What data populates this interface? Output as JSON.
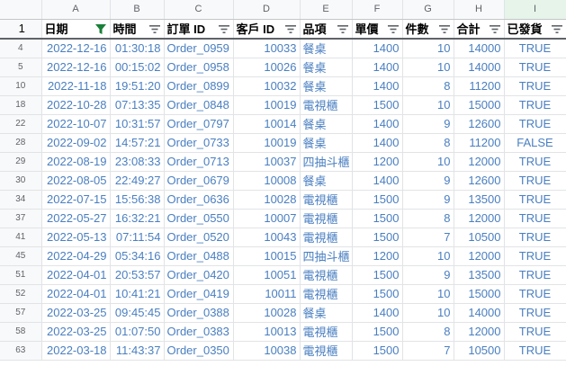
{
  "columns": [
    "A",
    "B",
    "C",
    "D",
    "E",
    "F",
    "G",
    "H",
    "I"
  ],
  "header_row_number": "1",
  "headers": [
    "日期",
    "時間",
    "訂單 ID",
    "客戶 ID",
    "品項",
    "單價",
    "件數",
    "合計",
    "已發貨"
  ],
  "rows": [
    {
      "n": "4",
      "date": "2022-12-16",
      "time": "01:30:18",
      "order": "Order_0959",
      "cust": "10033",
      "item": "餐桌",
      "price": "1400",
      "qty": "10",
      "total": "14000",
      "shipped": "TRUE"
    },
    {
      "n": "5",
      "date": "2022-12-16",
      "time": "00:15:02",
      "order": "Order_0958",
      "cust": "10026",
      "item": "餐桌",
      "price": "1400",
      "qty": "10",
      "total": "14000",
      "shipped": "TRUE"
    },
    {
      "n": "10",
      "date": "2022-11-18",
      "time": "19:51:20",
      "order": "Order_0899",
      "cust": "10032",
      "item": "餐桌",
      "price": "1400",
      "qty": "8",
      "total": "11200",
      "shipped": "TRUE"
    },
    {
      "n": "18",
      "date": "2022-10-28",
      "time": "07:13:35",
      "order": "Order_0848",
      "cust": "10019",
      "item": "電視櫃",
      "price": "1500",
      "qty": "10",
      "total": "15000",
      "shipped": "TRUE"
    },
    {
      "n": "22",
      "date": "2022-10-07",
      "time": "10:31:57",
      "order": "Order_0797",
      "cust": "10014",
      "item": "餐桌",
      "price": "1400",
      "qty": "9",
      "total": "12600",
      "shipped": "TRUE"
    },
    {
      "n": "28",
      "date": "2022-09-02",
      "time": "14:57:21",
      "order": "Order_0733",
      "cust": "10019",
      "item": "餐桌",
      "price": "1400",
      "qty": "8",
      "total": "11200",
      "shipped": "FALSE"
    },
    {
      "n": "29",
      "date": "2022-08-19",
      "time": "23:08:33",
      "order": "Order_0713",
      "cust": "10037",
      "item": "四抽斗櫃",
      "price": "1200",
      "qty": "10",
      "total": "12000",
      "shipped": "TRUE"
    },
    {
      "n": "30",
      "date": "2022-08-05",
      "time": "22:49:27",
      "order": "Order_0679",
      "cust": "10008",
      "item": "餐桌",
      "price": "1400",
      "qty": "9",
      "total": "12600",
      "shipped": "TRUE"
    },
    {
      "n": "34",
      "date": "2022-07-15",
      "time": "15:56:38",
      "order": "Order_0636",
      "cust": "10028",
      "item": "電視櫃",
      "price": "1500",
      "qty": "9",
      "total": "13500",
      "shipped": "TRUE"
    },
    {
      "n": "37",
      "date": "2022-05-27",
      "time": "16:32:21",
      "order": "Order_0550",
      "cust": "10007",
      "item": "電視櫃",
      "price": "1500",
      "qty": "8",
      "total": "12000",
      "shipped": "TRUE"
    },
    {
      "n": "41",
      "date": "2022-05-13",
      "time": "07:11:54",
      "order": "Order_0520",
      "cust": "10043",
      "item": "電視櫃",
      "price": "1500",
      "qty": "7",
      "total": "10500",
      "shipped": "TRUE"
    },
    {
      "n": "45",
      "date": "2022-04-29",
      "time": "05:34:16",
      "order": "Order_0488",
      "cust": "10015",
      "item": "四抽斗櫃",
      "price": "1200",
      "qty": "10",
      "total": "12000",
      "shipped": "TRUE"
    },
    {
      "n": "51",
      "date": "2022-04-01",
      "time": "20:53:57",
      "order": "Order_0420",
      "cust": "10051",
      "item": "電視櫃",
      "price": "1500",
      "qty": "9",
      "total": "13500",
      "shipped": "TRUE"
    },
    {
      "n": "52",
      "date": "2022-04-01",
      "time": "10:41:21",
      "order": "Order_0419",
      "cust": "10011",
      "item": "電視櫃",
      "price": "1500",
      "qty": "10",
      "total": "15000",
      "shipped": "TRUE"
    },
    {
      "n": "57",
      "date": "2022-03-25",
      "time": "09:45:45",
      "order": "Order_0388",
      "cust": "10028",
      "item": "餐桌",
      "price": "1400",
      "qty": "10",
      "total": "14000",
      "shipped": "TRUE"
    },
    {
      "n": "58",
      "date": "2022-03-25",
      "time": "01:07:50",
      "order": "Order_0383",
      "cust": "10013",
      "item": "電視櫃",
      "price": "1500",
      "qty": "8",
      "total": "12000",
      "shipped": "TRUE"
    },
    {
      "n": "63",
      "date": "2022-03-18",
      "time": "11:43:37",
      "order": "Order_0350",
      "cust": "10038",
      "item": "電視櫃",
      "price": "1500",
      "qty": "7",
      "total": "10500",
      "shipped": "TRUE"
    }
  ],
  "colors": {
    "cell_text": "#4a7fc1",
    "header_bg": "#f8f9fa",
    "active_filter": "#188038",
    "selected_column_bg": "#e6f4ea"
  },
  "icons": {
    "active_filter": "filter-active-icon",
    "filter": "filter-icon"
  }
}
